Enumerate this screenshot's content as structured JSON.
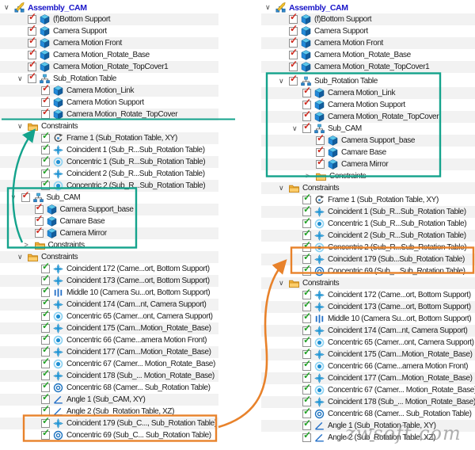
{
  "watermark": "zwsoft.com",
  "colors": {
    "highlight_teal": "#14A38C",
    "highlight_orange": "#E8822B",
    "root_text_blue": "#1A16C9",
    "check_red": "#CF2B20",
    "check_green": "#23A127",
    "row_stripe": "#F2F2F2"
  },
  "trees": {
    "left": {
      "rows": [
        {
          "label": "Assembly_CAM",
          "icon": "assembly",
          "chev": "open",
          "level": 0,
          "root": true
        },
        {
          "label": "(f)Bottom Support",
          "icon": "component",
          "check": "red",
          "level": 1
        },
        {
          "label": "Camera Support",
          "icon": "component",
          "check": "red",
          "level": 1
        },
        {
          "label": "Camera Motion Front",
          "icon": "component",
          "check": "red",
          "level": 1
        },
        {
          "label": "Camera Motion_Rotate_Base",
          "icon": "component",
          "check": "red",
          "level": 1
        },
        {
          "label": "Camera Motion_Rotate_TopCover1",
          "icon": "component",
          "check": "red",
          "level": 1
        },
        {
          "label": "Sub_Rotation Table",
          "icon": "subassembly",
          "check": "red",
          "chev": "open",
          "level": 1
        },
        {
          "label": "Camera Motion_Link",
          "icon": "component",
          "check": "red",
          "level": 2
        },
        {
          "label": "Camera Motion Support",
          "icon": "component",
          "check": "red",
          "level": 2
        },
        {
          "label": "Camera Motion_Rotate_TopCover",
          "icon": "component",
          "check": "red",
          "level": 2
        },
        {
          "label": "Constraints",
          "icon": "folder",
          "chev": "open",
          "level": 1
        },
        {
          "label": "Frame 1 (Sub_Rotation Table, XY)",
          "icon": "frame",
          "check": "green",
          "level": 2
        },
        {
          "label": "Coincident 1 (Sub_R...Sub_Rotation Table)",
          "icon": "coincident",
          "check": "green",
          "level": 2
        },
        {
          "label": "Concentric 1 (Sub_R...Sub_Rotation Table)",
          "icon": "concentric",
          "check": "green",
          "level": 2
        },
        {
          "label": "Coincident 2 (Sub_R...Sub_Rotation Table)",
          "icon": "coincident",
          "check": "green",
          "level": 2
        },
        {
          "label": "Concentric 2 (Sub_R...Sub_Rotation Table)",
          "icon": "concentric",
          "check": "green",
          "level": 2
        },
        {
          "label": "Sub_CAM",
          "icon": "subassembly",
          "check": "red",
          "chev": "open",
          "level": 0.5
        },
        {
          "label": "Camera Support_base",
          "icon": "component",
          "check": "red",
          "level": 1.5
        },
        {
          "label": "Camare Base",
          "icon": "component",
          "check": "red",
          "level": 1.5
        },
        {
          "label": "Camera Mirror",
          "icon": "component",
          "check": "red",
          "level": 1.5
        },
        {
          "label": "Constraints",
          "icon": "folder",
          "chev": "closed",
          "level": 1.5
        },
        {
          "label": "Constraints",
          "icon": "folder",
          "chev": "open",
          "level": 1
        },
        {
          "label": "Coincident 172 (Came...ort, Bottom Support)",
          "icon": "coincident",
          "check": "green",
          "level": 2
        },
        {
          "label": "Coincident 173 (Came...ort, Bottom Support)",
          "icon": "coincident",
          "check": "green",
          "level": 2
        },
        {
          "label": "Middle 10 (Camera Su...ort, Bottom Support)",
          "icon": "middle",
          "check": "green",
          "level": 2
        },
        {
          "label": "Coincident 174 (Cam...nt, Camera Support)",
          "icon": "coincident",
          "check": "green",
          "level": 2
        },
        {
          "label": "Concentric 65 (Camer...ont, Camera Support)",
          "icon": "concentric",
          "check": "green",
          "level": 2
        },
        {
          "label": "Coincident 175 (Cam...Motion_Rotate_Base)",
          "icon": "coincident",
          "check": "green",
          "level": 2
        },
        {
          "label": "Concentric 66 (Came...amera Motion Front)",
          "icon": "concentric",
          "check": "green",
          "level": 2
        },
        {
          "label": "Coincident 177 (Cam...Motion_Rotate_Base)",
          "icon": "coincident",
          "check": "green",
          "level": 2
        },
        {
          "label": "Concentric 67 (Camer... Motion_Rotate_Base)",
          "icon": "concentric",
          "check": "green",
          "level": 2
        },
        {
          "label": "Coincident 178 (Sub_... Motion_Rotate_Base)",
          "icon": "coincident",
          "check": "green",
          "level": 2
        },
        {
          "label": "Concentric 68 (Camer... Sub_Rotation Table)",
          "icon": "concentric-ring",
          "check": "green",
          "level": 2
        },
        {
          "label": "Angle 1 (Sub_CAM, XY)",
          "icon": "angle",
          "check": "green",
          "level": 2
        },
        {
          "label": "Angle 2 (Sub_Rotation Table, XZ)",
          "icon": "angle",
          "check": "green",
          "level": 2
        },
        {
          "label": "Coincident 179 (Sub_C..., Sub_Rotation Table)",
          "icon": "coincident",
          "check": "green",
          "level": 2
        },
        {
          "label": "Concentric 69 (Sub_C... Sub_Rotation Table)",
          "icon": "concentric-ring",
          "check": "green",
          "level": 2
        }
      ]
    },
    "right": {
      "rows": [
        {
          "label": "Assembly_CAM",
          "icon": "assembly",
          "chev": "open",
          "level": 0,
          "root": true
        },
        {
          "label": "(f)Bottom Support",
          "icon": "component",
          "check": "red",
          "level": 1
        },
        {
          "label": "Camera Support",
          "icon": "component",
          "check": "red",
          "level": 1
        },
        {
          "label": "Camera Motion Front",
          "icon": "component",
          "check": "red",
          "level": 1
        },
        {
          "label": "Camera Motion_Rotate_Base",
          "icon": "component",
          "check": "red",
          "level": 1
        },
        {
          "label": "Camera Motion_Rotate_TopCover1",
          "icon": "component",
          "check": "red",
          "level": 1
        },
        {
          "label": "Sub_Rotation Table",
          "icon": "subassembly",
          "check": "red",
          "chev": "open",
          "level": 1,
          "gap": 3
        },
        {
          "label": "Camera Motion_Link",
          "icon": "component",
          "check": "red",
          "level": 2
        },
        {
          "label": "Camera Motion Support",
          "icon": "component",
          "check": "red",
          "level": 2
        },
        {
          "label": "Camera Motion_Rotate_TopCover",
          "icon": "component",
          "check": "red",
          "level": 2
        },
        {
          "label": "Sub_CAM",
          "icon": "subassembly",
          "check": "red",
          "chev": "open",
          "level": 2
        },
        {
          "label": "Camera Support_base",
          "icon": "component",
          "check": "red",
          "level": 3
        },
        {
          "label": "Camare Base",
          "icon": "component",
          "check": "red",
          "level": 3
        },
        {
          "label": "Camera Mirror",
          "icon": "component",
          "check": "red",
          "level": 3
        },
        {
          "label": "Constraints",
          "icon": "folder",
          "chev": "closed",
          "level": 3
        },
        {
          "label": "Constraints",
          "icon": "folder",
          "chev": "open",
          "level": 1
        },
        {
          "label": "Frame 1 (Sub_Rotation Table, XY)",
          "icon": "frame",
          "check": "green",
          "level": 2
        },
        {
          "label": "Coincident 1 (Sub_R...Sub_Rotation Table)",
          "icon": "coincident",
          "check": "green",
          "level": 2
        },
        {
          "label": "Concentric 1 (Sub_R...Sub_Rotation Table)",
          "icon": "concentric",
          "check": "green",
          "level": 2
        },
        {
          "label": "Coincident 2 (Sub_R...Sub_Rotation Table)",
          "icon": "coincident",
          "check": "green",
          "level": 2
        },
        {
          "label": "Concentric 2 (Sub_R...Sub_Rotation Table)",
          "icon": "concentric",
          "check": "green",
          "level": 2
        },
        {
          "label": "Coincident 179 (Sub...Sub_Rotation Table)",
          "icon": "coincident",
          "check": "green",
          "level": 2
        },
        {
          "label": "Concentric 69 (Sub_...Sub_Rotation Table)",
          "icon": "concentric-ring",
          "check": "green",
          "level": 2
        },
        {
          "label": "Constraints",
          "icon": "folder",
          "chev": "open",
          "level": 1
        },
        {
          "label": "Coincident 172 (Came...ort, Bottom Support)",
          "icon": "coincident",
          "check": "green",
          "level": 2
        },
        {
          "label": "Coincident 173 (Came...ort, Bottom Support)",
          "icon": "coincident",
          "check": "green",
          "level": 2
        },
        {
          "label": "Middle 10 (Camera Su...ort, Bottom Support)",
          "icon": "middle",
          "check": "green",
          "level": 2
        },
        {
          "label": "Coincident 174 (Cam...nt, Camera Support)",
          "icon": "coincident",
          "check": "green",
          "level": 2
        },
        {
          "label": "Concentric 65 (Camer...ont, Camera Support)",
          "icon": "concentric",
          "check": "green",
          "level": 2
        },
        {
          "label": "Coincident 175 (Cam...Motion_Rotate_Base)",
          "icon": "coincident",
          "check": "green",
          "level": 2
        },
        {
          "label": "Concentric 66 (Came...amera Motion Front)",
          "icon": "concentric",
          "check": "green",
          "level": 2
        },
        {
          "label": "Coincident 177 (Cam...Motion_Rotate_Base)",
          "icon": "coincident",
          "check": "green",
          "level": 2
        },
        {
          "label": "Concentric 67 (Camer... Motion_Rotate_Base)",
          "icon": "concentric",
          "check": "green",
          "level": 2
        },
        {
          "label": "Coincident 178 (Sub_... Motion_Rotate_Base)",
          "icon": "coincident",
          "check": "green",
          "level": 2
        },
        {
          "label": "Concentric 68 (Camer... Sub_Rotation Table)",
          "icon": "concentric-ring",
          "check": "green",
          "level": 2
        },
        {
          "label": "Angle 1 (Sub_Rotation Table, XY)",
          "icon": "angle",
          "check": "green",
          "level": 2
        },
        {
          "label": "Angle 2 (Sub_Rotation Table, XZ)",
          "icon": "angle",
          "check": "green",
          "level": 2
        }
      ]
    }
  }
}
